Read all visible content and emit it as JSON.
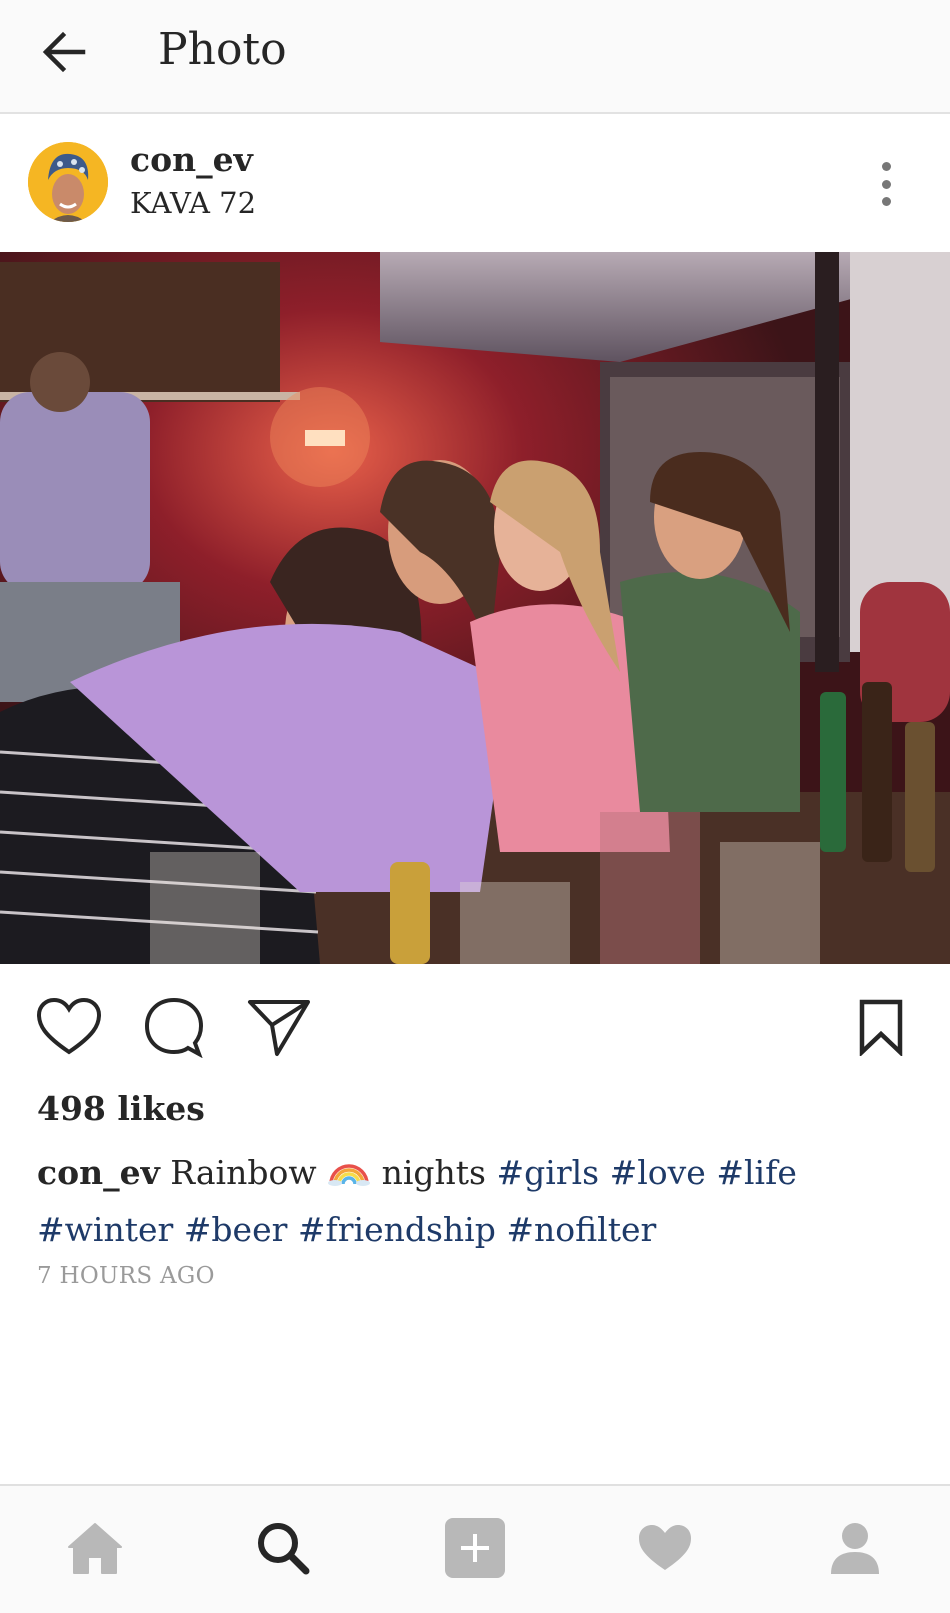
{
  "header": {
    "title": "Photo",
    "back_icon": "arrow-left-icon"
  },
  "post": {
    "username": "con_ev",
    "location": "KAVA 72",
    "more_icon": "more-vertical-icon",
    "photo_description_icon": "group-photo",
    "actions": {
      "like_icon": "heart-outline-icon",
      "comment_icon": "comment-bubble-icon",
      "share_icon": "send-paper-plane-icon",
      "save_icon": "bookmark-icon"
    },
    "likes_text": "498 likes",
    "caption": {
      "username": "con_ev",
      "text_before": "Rainbow",
      "emoji": "🌈",
      "text_after": "nights",
      "hashtags_line1": [
        "#girls",
        "#love",
        "#life"
      ],
      "hashtags_line2": [
        "#winter",
        "#beer",
        "#friendship",
        "#nofilter"
      ]
    },
    "timestamp": "7 HOURS AGO"
  },
  "bottom_nav": {
    "items": [
      {
        "name": "home",
        "icon": "home-icon"
      },
      {
        "name": "search",
        "icon": "search-icon"
      },
      {
        "name": "add",
        "icon": "add-post-icon"
      },
      {
        "name": "activity",
        "icon": "heart-filled-icon"
      },
      {
        "name": "profile",
        "icon": "profile-icon"
      }
    ]
  },
  "colors": {
    "hashtag": "#1e3a68",
    "text": "#262626",
    "muted": "#9a9a9a",
    "nav_inactive": "#b8b8b8",
    "nav_active": "#262626"
  }
}
